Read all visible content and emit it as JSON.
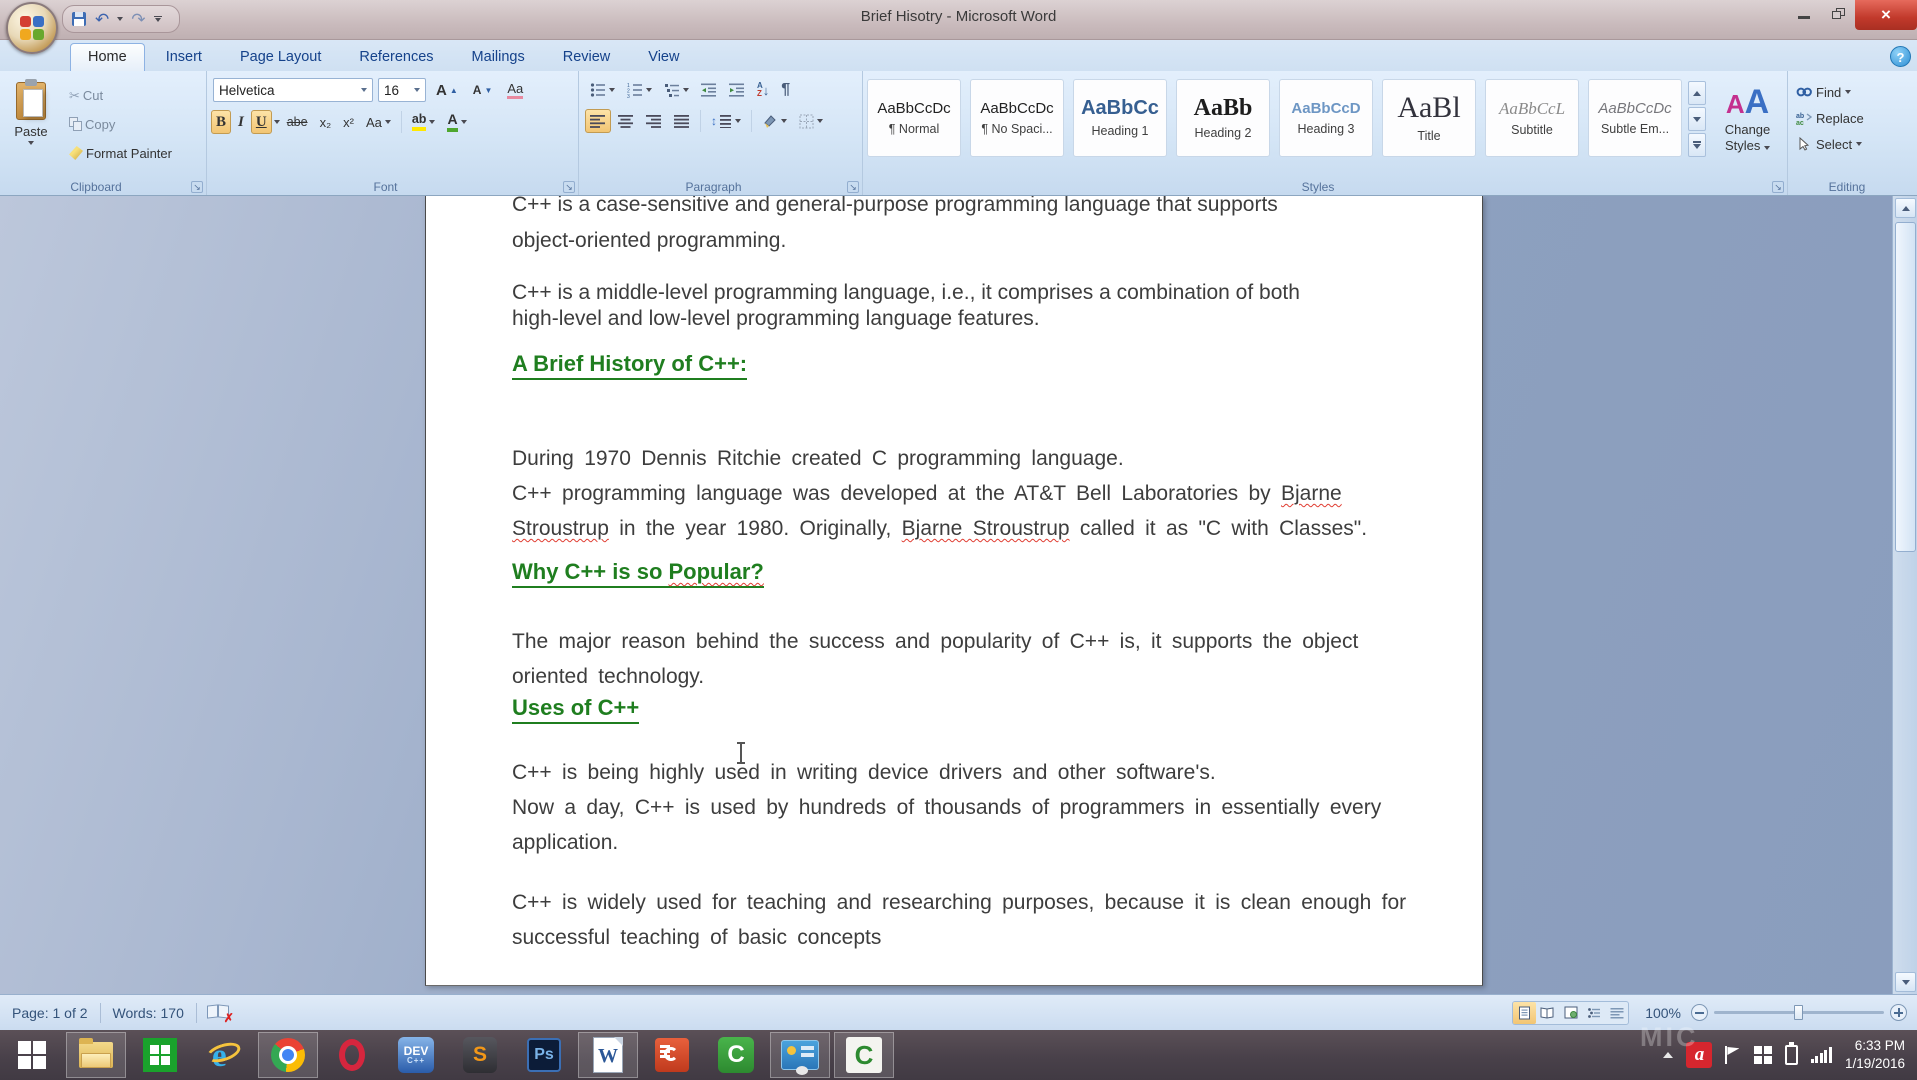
{
  "window": {
    "title": "Brief Hisotry - Microsoft Word",
    "close_glyph": "×",
    "help_glyph": "?"
  },
  "qat": {
    "undo_glyph": "↶",
    "redo_glyph": "↷"
  },
  "ribbon": {
    "tabs": [
      {
        "label": "Home"
      },
      {
        "label": "Insert"
      },
      {
        "label": "Page Layout"
      },
      {
        "label": "References"
      },
      {
        "label": "Mailings"
      },
      {
        "label": "Review"
      },
      {
        "label": "View"
      }
    ],
    "clipboard": {
      "group_label": "Clipboard",
      "paste": "Paste",
      "cut": "Cut",
      "copy": "Copy",
      "format_painter": "Format Painter",
      "cut_glyph": "✂"
    },
    "font": {
      "group_label": "Font",
      "font_name": "Helvetica",
      "font_size": "16",
      "grow": "A",
      "shrink": "A",
      "clear": "Aa",
      "bold": "B",
      "italic": "I",
      "underline": "U",
      "strike": "abe",
      "subscript": "x₂",
      "superscript": "x²",
      "change_case": "Aa",
      "highlight": "ab",
      "font_color": "A"
    },
    "paragraph": {
      "group_label": "Paragraph",
      "pilcrow": "¶",
      "sort_a": "A",
      "sort_z": "Z",
      "sort_arrow": "↓",
      "spacing_arrow": "↕"
    },
    "styles": {
      "group_label": "Styles",
      "chips": [
        {
          "preview": "AaBbCcDc",
          "label": "¶ Normal"
        },
        {
          "preview": "AaBbCcDc",
          "label": "¶ No Spaci..."
        },
        {
          "preview": "AaBbCc",
          "label": "Heading 1"
        },
        {
          "preview": "AaBb",
          "label": "Heading 2"
        },
        {
          "preview": "AaBbCcD",
          "label": "Heading 3"
        },
        {
          "preview": "AaBl",
          "label": "Title"
        },
        {
          "preview": "AaBbCcL",
          "label": "Subtitle"
        },
        {
          "preview": "AaBbCcDc",
          "label": "Subtle Em..."
        }
      ],
      "change_styles_a1": "A",
      "change_styles_a2": "A",
      "change_styles_line1": "Change",
      "change_styles_line2": "Styles"
    },
    "editing": {
      "group_label": "Editing",
      "find": "Find",
      "replace": "Replace",
      "select": "Select"
    }
  },
  "document": {
    "para1_line1": "C++ is a case-sensitive and general-purpose programming language that supports",
    "para1_line2": "object-oriented programming.",
    "para2_line1": "C++ is a middle-level programming language, i.e., it comprises a combination of both",
    "para2_line2": "high-level and low-level programming language features.",
    "heading1": "A Brief History of C++:",
    "para3_line1": "During 1970 Dennis Ritchie created C programming language.",
    "para3_line2_pre": "C++ programming language was developed at the AT&T Bell Laboratories by ",
    "para3_line2_misspell": "Bjarne",
    "para3_line3_m1": "Stroustrup",
    "para3_line3_mid": " in the year 1980. Originally, ",
    "para3_line3_m2": "Bjarne Stroustrup",
    "para3_line3_post": " called it as \"C with Classes\".",
    "heading2_pre": "Why C++ is so ",
    "heading2_misspell": "Popular?",
    "para4_line1": "The major reason behind the success and popularity of C++ is, it supports the object",
    "para4_line2": "oriented technology.",
    "heading3": "Uses of C++",
    "para5_line1": "C++ is being highly used in writing device drivers and other software's.",
    "para5_line2": "Now a day, C++ is used by hundreds of thousands of programmers in essentially every",
    "para5_line3": "application.",
    "para6_line1": "C++ is widely used for teaching and researching purposes, because it is clean enough for",
    "para6_line2": "successful teaching of basic concepts"
  },
  "status_bar": {
    "page": "Page: 1 of 2",
    "words": "Words: 170",
    "zoom": "100%"
  },
  "taskbar": {
    "ie_glyph": "e",
    "dev_glyph": "DEV",
    "dev_sub": "C++",
    "sublime_glyph": "S",
    "ps_glyph": "Ps",
    "word_glyph": "W",
    "camtasia_glyph": "C",
    "recorder_glyph": "C",
    "avira_glyph": "a"
  },
  "tray": {
    "time": "6:33 PM",
    "date": "1/19/2016",
    "watermark": "MIC"
  },
  "colors": {
    "heading_green": "#1f7e1f",
    "squiggle_red": "#e03c31",
    "toggle_orange": "#f2c573",
    "close_red": "#c1392b"
  }
}
